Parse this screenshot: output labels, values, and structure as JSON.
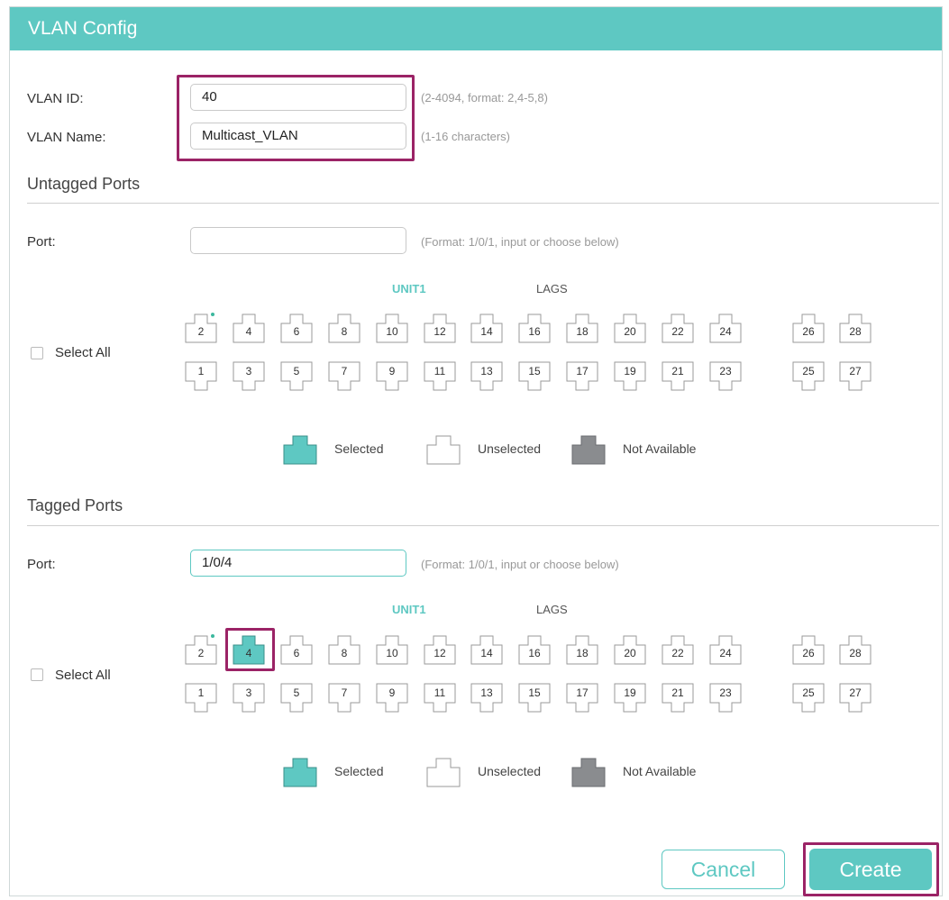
{
  "dialog": {
    "title": "VLAN Config"
  },
  "vlan_id": {
    "label": "VLAN ID:",
    "value": "40",
    "hint": "(2-4094, format: 2,4-5,8)"
  },
  "vlan_name": {
    "label": "VLAN Name:",
    "value": "Multicast_VLAN",
    "hint": "(1-16 characters)"
  },
  "untagged": {
    "title": "Untagged Ports",
    "port_label": "Port:",
    "port_value": "",
    "port_hint": "(Format: 1/0/1, input or choose below)",
    "unit_label": "UNIT1",
    "lags_label": "LAGS",
    "select_all": "Select All",
    "top_ports": [
      "2",
      "4",
      "6",
      "8",
      "10",
      "12",
      "14",
      "16",
      "18",
      "20",
      "22",
      "24"
    ],
    "bottom_ports": [
      "1",
      "3",
      "5",
      "7",
      "9",
      "11",
      "13",
      "15",
      "17",
      "19",
      "21",
      "23"
    ],
    "extra_top": [
      "26",
      "28"
    ],
    "extra_bottom": [
      "25",
      "27"
    ],
    "selected": []
  },
  "tagged": {
    "title": "Tagged Ports",
    "port_label": "Port:",
    "port_value": "1/0/4",
    "port_hint": "(Format: 1/0/1, input or choose below)",
    "unit_label": "UNIT1",
    "lags_label": "LAGS",
    "select_all": "Select All",
    "top_ports": [
      "2",
      "4",
      "6",
      "8",
      "10",
      "12",
      "14",
      "16",
      "18",
      "20",
      "22",
      "24"
    ],
    "bottom_ports": [
      "1",
      "3",
      "5",
      "7",
      "9",
      "11",
      "13",
      "15",
      "17",
      "19",
      "21",
      "23"
    ],
    "extra_top": [
      "26",
      "28"
    ],
    "extra_bottom": [
      "25",
      "27"
    ],
    "selected": [
      "4"
    ]
  },
  "legend": {
    "selected": "Selected",
    "unselected": "Unselected",
    "not_available": "Not Available"
  },
  "colors": {
    "accent": "#5ec8c2",
    "highlight": "#9b2366",
    "not_available": "#8a8c8f",
    "link_dot": "#3cb89e"
  },
  "buttons": {
    "cancel": "Cancel",
    "create": "Create"
  }
}
